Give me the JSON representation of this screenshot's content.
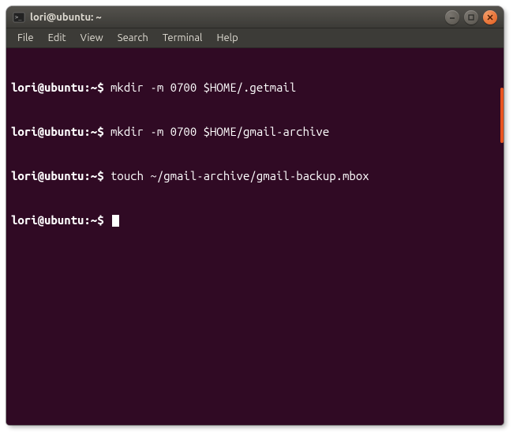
{
  "window": {
    "title": "lori@ubuntu: ~"
  },
  "menubar": {
    "items": [
      {
        "label": "File"
      },
      {
        "label": "Edit"
      },
      {
        "label": "View"
      },
      {
        "label": "Search"
      },
      {
        "label": "Terminal"
      },
      {
        "label": "Help"
      }
    ]
  },
  "terminal": {
    "lines": [
      {
        "prompt": "lori@ubuntu:~$",
        "command": "mkdir -m 0700 $HOME/.getmail"
      },
      {
        "prompt": "lori@ubuntu:~$",
        "command": "mkdir -m 0700 $HOME/gmail-archive"
      },
      {
        "prompt": "lori@ubuntu:~$",
        "command": "touch ~/gmail-archive/gmail-backup.mbox"
      },
      {
        "prompt": "lori@ubuntu:~$",
        "command": ""
      }
    ]
  }
}
